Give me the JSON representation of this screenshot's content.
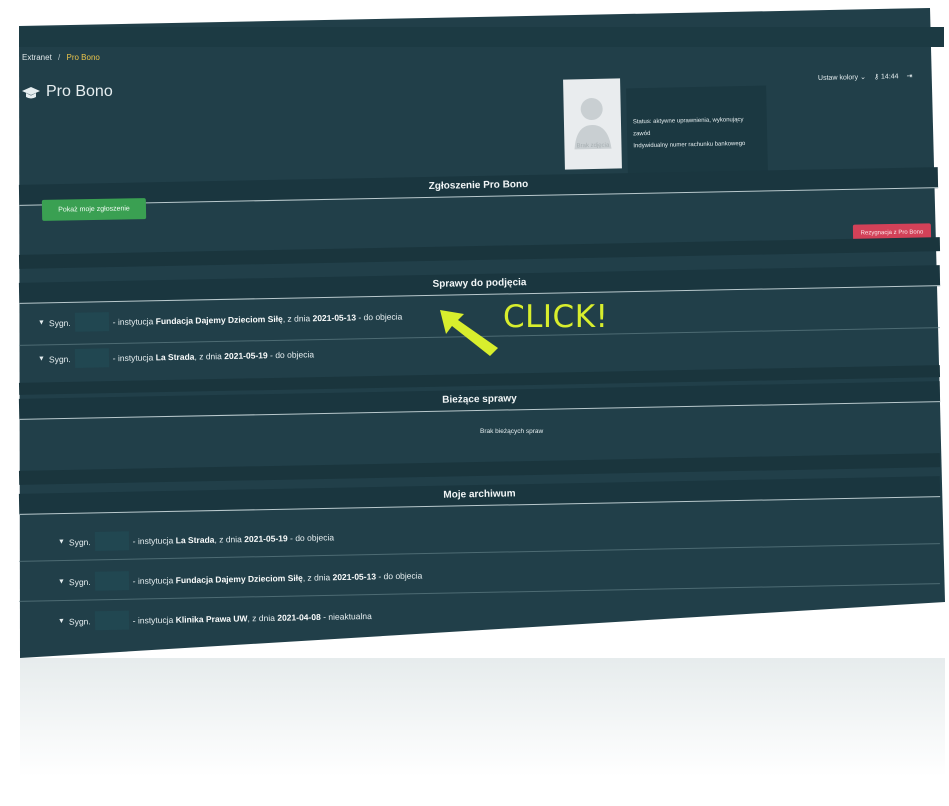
{
  "breadcrumb": {
    "root": "Extranet",
    "separator": "/",
    "current": "Pro Bono"
  },
  "header": {
    "title": "Pro Bono",
    "colors_menu": "Ustaw kolory",
    "time": "14:44"
  },
  "profile": {
    "avatar_caption": "Brak zdjęcia",
    "status_line": "Status: aktywne uprawnienia, wykonujący zawód",
    "account_line": "Indywidualny numer rachunku bankowego"
  },
  "zgloszenie": {
    "title": "Zgłoszenie Pro Bono",
    "show_button": "Pokaż moje zgłoszenie",
    "resign_button": "Rezygnacja z Pro Bono"
  },
  "sprawy": {
    "title": "Sprawy do podjęcia",
    "rows": [
      {
        "prefix": "Sygn.",
        "mid": "- instytucja",
        "institution": "Fundacja Dajemy Dzieciom Siłę",
        "date_prefix": ", z dnia",
        "date": "2021-05-13",
        "status": "- do objecia"
      },
      {
        "prefix": "Sygn.",
        "mid": "- instytucja",
        "institution": "La Strada",
        "date_prefix": ", z dnia",
        "date": "2021-05-19",
        "status": "- do objecia"
      }
    ]
  },
  "biezace": {
    "title": "Bieżące sprawy",
    "empty": "Brak bieżących spraw"
  },
  "archiwum": {
    "title": "Moje archiwum",
    "rows": [
      {
        "prefix": "Sygn.",
        "mid": "- instytucja",
        "institution": "La Strada",
        "date_prefix": ", z dnia",
        "date": "2021-05-19",
        "status": "- do objecia"
      },
      {
        "prefix": "Sygn.",
        "mid": "- instytucja",
        "institution": "Fundacja Dajemy Dzieciom Siłę",
        "date_prefix": ", z dnia",
        "date": "2021-05-13",
        "status": "- do objecia"
      },
      {
        "prefix": "Sygn.",
        "mid": "- instytucja",
        "institution": "Klinika Prawa UW",
        "date_prefix": ", z dnia",
        "date": "2021-04-08",
        "status": "- nieaktualna"
      }
    ]
  },
  "annotation": {
    "text": "CLICK!",
    "color": "#d8ee2d"
  },
  "colors": {
    "background": "#213f49",
    "green": "#3aa052",
    "red": "#d34158",
    "accent_yellow": "#e9c44b"
  }
}
